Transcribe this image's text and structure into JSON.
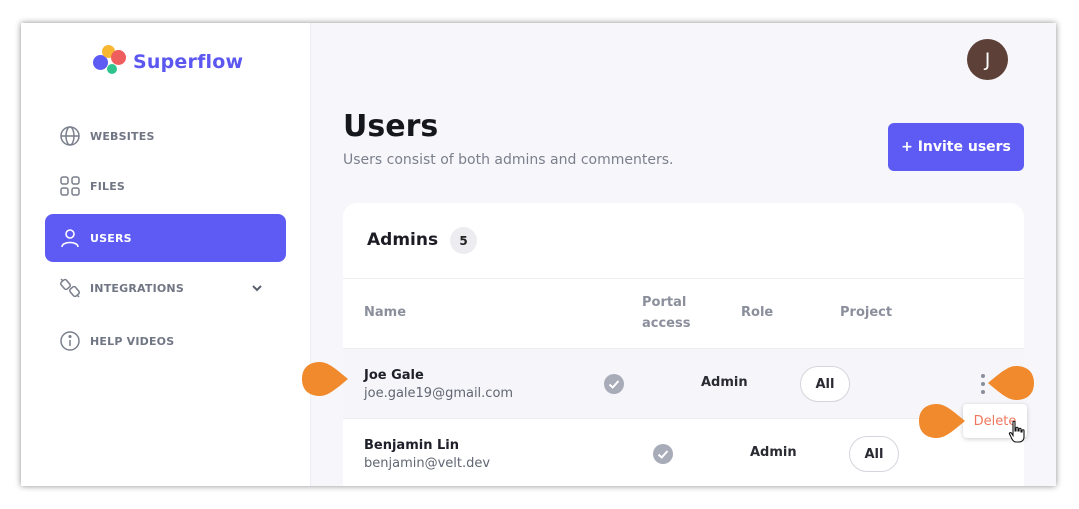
{
  "app": {
    "name": "Superflow"
  },
  "sidebar": {
    "items": [
      {
        "label": "WEBSITES",
        "icon": "globe-icon"
      },
      {
        "label": "FILES",
        "icon": "grid-icon"
      },
      {
        "label": "USERS",
        "icon": "user-icon",
        "active": true
      },
      {
        "label": "INTEGRATIONS",
        "icon": "plug-icon",
        "has_submenu": true
      },
      {
        "label": "HELP VIDEOS",
        "icon": "info-icon"
      }
    ]
  },
  "header": {
    "avatar_initial": "J"
  },
  "page": {
    "title": "Users",
    "subtitle": "Users consist of both admins and commenters.",
    "invite_label": "+ Invite users"
  },
  "admins": {
    "title": "Admins",
    "count": "5",
    "columns": {
      "name": "Name",
      "portal_line1": "Portal",
      "portal_line2": "access",
      "role": "Role",
      "project": "Project"
    },
    "rows": [
      {
        "name": "Joe Gale",
        "email": "joe.gale19@gmail.com",
        "portal_access": true,
        "role": "Admin",
        "project": "All"
      },
      {
        "name": "Benjamin Lin",
        "email": "benjamin@velt.dev",
        "portal_access": true,
        "role": "Admin",
        "project": "All"
      }
    ]
  },
  "row_menu": {
    "delete_label": "Delete"
  },
  "colors": {
    "accent": "#5e5bf4",
    "brand_text": "#5b57f0",
    "annotation_marker": "#f08a2c",
    "delete_text": "#f0775d"
  }
}
